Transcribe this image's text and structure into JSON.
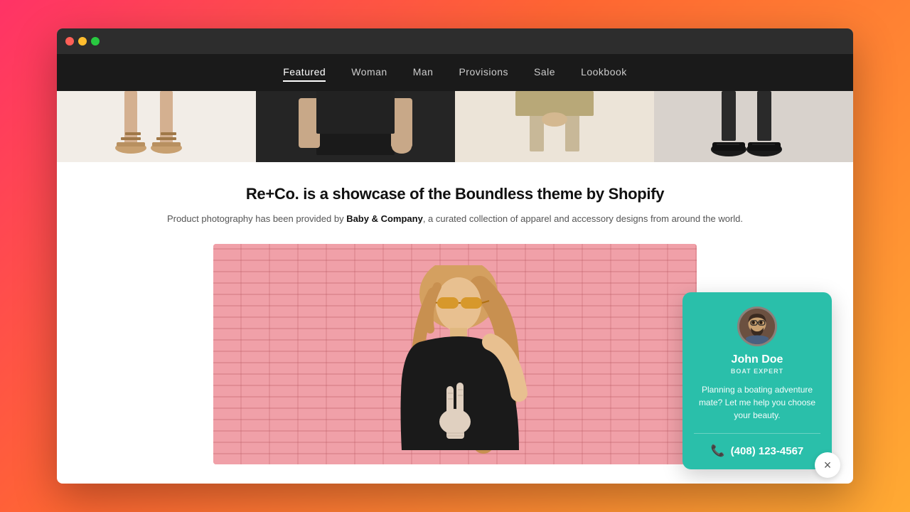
{
  "browser": {
    "traffic_lights": [
      "red",
      "yellow",
      "green"
    ]
  },
  "nav": {
    "items": [
      {
        "label": "Featured",
        "active": true
      },
      {
        "label": "Woman",
        "active": false
      },
      {
        "label": "Man",
        "active": false
      },
      {
        "label": "Provisions",
        "active": false
      },
      {
        "label": "Sale",
        "active": false
      },
      {
        "label": "Lookbook",
        "active": false
      }
    ]
  },
  "about": {
    "title": "Re+Co. is a showcase of the Boundless theme by Shopify",
    "desc_before": "Product photography has been provided by ",
    "brand": "Baby & Company",
    "desc_after": ", a curated collection of apparel and accessory designs from around the world."
  },
  "chat_widget": {
    "agent_name": "John Doe",
    "agent_title": "BOAT EXPERT",
    "message": "Planning a boating adventure mate? Let me help you choose your beauty.",
    "phone": "(408) 123-4567"
  },
  "close_button": {
    "label": "×"
  }
}
